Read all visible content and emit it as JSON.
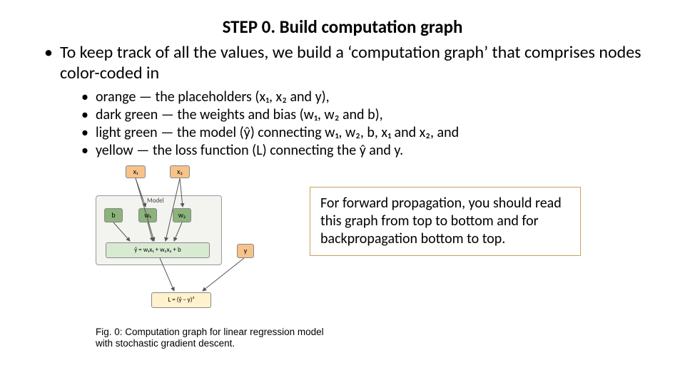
{
  "title": "STEP 0. Build computation graph",
  "intro": "To keep track of all the values, we build a ‘computation graph’ that comprises nodes color-coded in",
  "bullets": [
    "orange — the placeholders (x₁, x₂ and y),",
    "dark green — the weights and bias (w₁, w₂ and b),",
    "light green — the model (ŷ) connecting w₁, w₂, b, x₁ and x₂, and",
    "yellow — the loss function (L) connecting the ŷ and y."
  ],
  "diagram": {
    "model_label": "Model",
    "x1": "x₁",
    "x2": "x₂",
    "b": "b",
    "w1": "w₁",
    "w2": "w₂",
    "yhat_eq": "ŷ = w₁x₁ + w₂x₂ + b",
    "y": "y",
    "loss_eq": "L = (ŷ − y)²"
  },
  "callout": "For forward propagation, you should read this graph from top to bottom and for backpropagation bottom to top.",
  "caption": "Fig. 0: Computation graph for linear regression model with stochastic gradient descent."
}
